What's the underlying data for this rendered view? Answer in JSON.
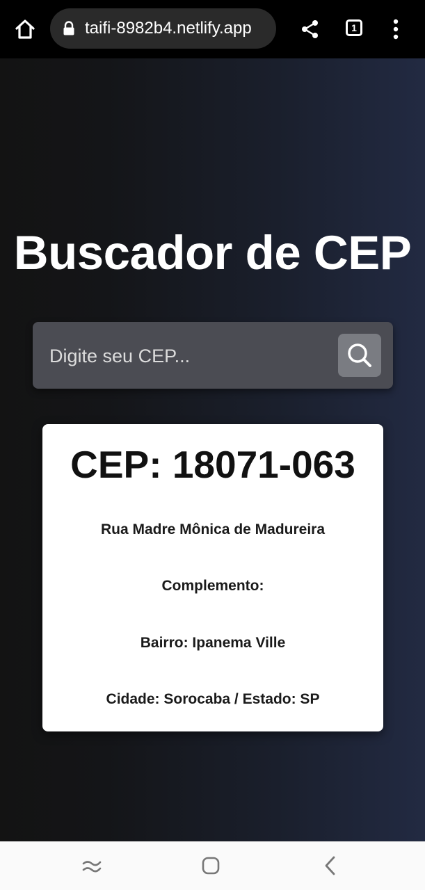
{
  "browser": {
    "url": "taifi-8982b4.netlify.app",
    "tab_count": "1",
    "icons": [
      "home-icon",
      "lock-icon",
      "share-icon",
      "tabs-icon",
      "menu-icon"
    ]
  },
  "page": {
    "title": "Buscador de CEP",
    "search": {
      "placeholder": "Digite seu CEP...",
      "value": "",
      "button_icon": "search-icon"
    },
    "result": {
      "cep": "CEP: 18071-063",
      "logradouro": "Rua Madre Mônica de Madureira",
      "complemento": "Complemento:",
      "bairro": "Bairro: Ipanema Ville",
      "cidade_estado": "Cidade: Sorocaba / Estado: SP"
    }
  },
  "nav": {
    "icons": [
      "recents-icon",
      "home-icon",
      "back-icon"
    ]
  },
  "colors": {
    "background_start": "#131313",
    "background_end": "#222a42",
    "search_box": "#4b4c53",
    "search_button": "#7a7c82",
    "card": "#ffffff",
    "browser_bar": "#000000"
  }
}
